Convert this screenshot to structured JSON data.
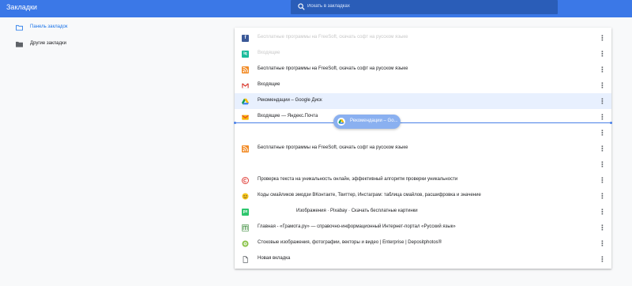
{
  "app": {
    "title": "Закладки"
  },
  "search": {
    "placeholder": "Искать в закладках"
  },
  "sidebar": {
    "items": [
      {
        "label": "Панель закладок",
        "active": true
      },
      {
        "label": "Другие закладки",
        "active": false
      }
    ]
  },
  "bookmarks": [
    {
      "title": "",
      "icon": "facebook-icon",
      "color": "#3b5998",
      "glyph": "f"
    },
    {
      "title": "",
      "icon": "iq-icon",
      "color": "#1abc9c",
      "glyph": "iq"
    },
    {
      "title": "Бесплатные программы на FreeSoft, скачать софт на русском языке",
      "icon": "rss-icon",
      "color": "#f28c28",
      "glyph": ""
    },
    {
      "title": "Входящие",
      "icon": "gmail-icon",
      "color": "#ffffff",
      "glyph": "M"
    },
    {
      "title": "Рекомендации – Google Диск",
      "icon": "google-drive-icon",
      "color": "",
      "glyph": ""
    },
    {
      "title": "Входящие — Яндекс.Почта",
      "icon": "yandex-mail-icon",
      "color": "#f7b500",
      "glyph": ""
    },
    {
      "title": "",
      "icon": "",
      "color": "",
      "glyph": ""
    },
    {
      "title": "Бесплатные программы на FreeSoft, скачать софт на русском языке",
      "icon": "rss-icon",
      "color": "#f28c28",
      "glyph": ""
    },
    {
      "title": "",
      "icon": "",
      "color": "",
      "glyph": ""
    },
    {
      "title": "Проверка текста на уникальность онлайн, эффективный алгоритм проверки уникальности",
      "icon": "text-ru-icon",
      "color": "#e0413b",
      "glyph": "©"
    },
    {
      "title": "Коды смайликов эмодзи ВКонтакте, Твиттер, Инстаграм: таблица смайлов, расшифровка и значение",
      "icon": "smiley-icon",
      "color": "#f5c518",
      "glyph": "☺"
    },
    {
      "title": "Изображения · Pixabay · Скачать бесплатные картинки",
      "icon": "pixabay-icon",
      "color": "#2ec66d",
      "glyph": "px"
    },
    {
      "title": "Главная - «Грамота.ру» — справочно-информационный Интернет-портал «Русский язык»",
      "icon": "gramota-icon",
      "color": "#3c8c3c",
      "glyph": ""
    },
    {
      "title": "Стоковые изображения, фотографии, векторы и видео | Enterprise | Depositphotos®",
      "icon": "depositphotos-icon",
      "color": "#8bc34a",
      "glyph": ""
    },
    {
      "title": "Новая вкладка",
      "icon": "page-icon",
      "color": "",
      "glyph": ""
    }
  ],
  "ghost_rows": [
    "Бесплатные программы на FreeSoft, скачать софт на русском языке",
    "Входящие"
  ],
  "drag_chip": {
    "label": "Рекомендации – Go..."
  }
}
